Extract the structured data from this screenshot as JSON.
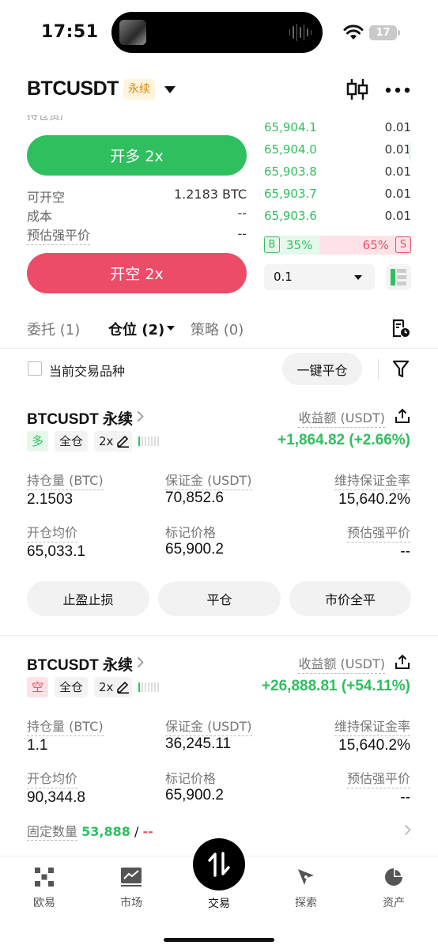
{
  "status": {
    "time": "17:51",
    "battery": "17"
  },
  "header": {
    "pair": "BTCUSDT",
    "perp_tag": "永续"
  },
  "form": {
    "long_button": "开多 2x",
    "short_button": "开空 2x",
    "info": [
      {
        "label": "可开空",
        "value": "1.2183 BTC"
      },
      {
        "label": "成本",
        "value": "--"
      },
      {
        "label": "预估强平价",
        "value": "--"
      }
    ]
  },
  "orderbook": {
    "bids": [
      {
        "price": "65,904.1",
        "qty": "0.01"
      },
      {
        "price": "65,904.0",
        "qty": "0.01"
      },
      {
        "price": "65,903.8",
        "qty": "0.01"
      },
      {
        "price": "65,903.7",
        "qty": "0.01"
      },
      {
        "price": "65,903.6",
        "qty": "0.01"
      }
    ],
    "buy_label": "B",
    "buy_pct": "35%",
    "sell_pct": "65%",
    "sell_label": "S",
    "qty_step": "0.1"
  },
  "tabs": [
    {
      "label": "委托 (1)"
    },
    {
      "label": "仓位 (2)"
    },
    {
      "label": "策略 (0)"
    }
  ],
  "filter": {
    "checkbox_label": "当前交易品种",
    "close_all": "一键平仓"
  },
  "positions": [
    {
      "title": "BTCUSDT 永续",
      "pnl_label": "收益额 (USDT)",
      "side": "多",
      "margin_mode": "全仓",
      "leverage": "2x",
      "pnl": "+1,864.82 (+2.66%)",
      "size_label": "持仓量 (BTC)",
      "size": "2.1503",
      "margin_label": "保证金 (USDT)",
      "margin": "70,852.6",
      "mmr_label": "维持保证金率",
      "mmr": "15,640.2%",
      "entry_label": "开仓均价",
      "entry": "65,033.1",
      "mark_label": "标记价格",
      "mark": "65,900.2",
      "liq_label": "预估强平价",
      "liq": "--",
      "actions": [
        "止盈止损",
        "平仓",
        "市价全平"
      ]
    },
    {
      "title": "BTCUSDT 永续",
      "pnl_label": "收益额 (USDT)",
      "side": "空",
      "margin_mode": "全仓",
      "leverage": "2x",
      "pnl": "+26,888.81 (+54.11%)",
      "size_label": "持仓量 (BTC)",
      "size": "1.1",
      "margin_label": "保证金 (USDT)",
      "margin": "36,245.11",
      "mmr_label": "维持保证金率",
      "mmr": "15,640.2%",
      "entry_label": "开仓均价",
      "entry": "90,344.8",
      "mark_label": "标记价格",
      "mark": "65,900.2",
      "liq_label": "预估强平价",
      "liq": "--",
      "fixed_label": "固定数量",
      "fixed_value": "53,888",
      "fixed_sep": "/",
      "fixed_value2": "--"
    }
  ],
  "nav": [
    {
      "label": "欧易",
      "icon": "okx-logo-icon"
    },
    {
      "label": "市场",
      "icon": "market-chart-icon"
    },
    {
      "label": "交易",
      "icon": "trade-swap-icon"
    },
    {
      "label": "探索",
      "icon": "compass-icon"
    },
    {
      "label": "资产",
      "icon": "pie-chart-icon"
    }
  ],
  "colors": {
    "green": "#2fbf5e",
    "red": "#ec4c67",
    "tag_bg": "#fff4dc",
    "tag_fg": "#d98a10"
  }
}
